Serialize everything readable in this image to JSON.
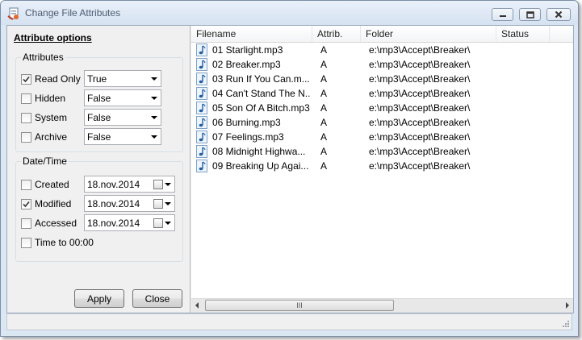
{
  "window": {
    "title": "Change File Attributes"
  },
  "left_panel": {
    "heading": "Attribute options",
    "attributes_group": {
      "label": "Attributes",
      "items": [
        {
          "label": "Read Only",
          "checked": true,
          "value": "True"
        },
        {
          "label": "Hidden",
          "checked": false,
          "value": "False"
        },
        {
          "label": "System",
          "checked": false,
          "value": "False"
        },
        {
          "label": "Archive",
          "checked": false,
          "value": "False"
        }
      ]
    },
    "datetime_group": {
      "label": "Date/Time",
      "items": [
        {
          "label": "Created",
          "checked": false,
          "date": "18.nov.2014"
        },
        {
          "label": "Modified",
          "checked": true,
          "date": "18.nov.2014"
        },
        {
          "label": "Accessed",
          "checked": false,
          "date": "18.nov.2014"
        }
      ],
      "time_label": "Time to 00:00",
      "time_checked": false
    },
    "apply_label": "Apply",
    "close_label": "Close"
  },
  "list": {
    "columns": [
      "Filename",
      "Attrib.",
      "Folder",
      "Status"
    ],
    "rows": [
      {
        "filename": "01 Starlight.mp3",
        "attrib": "A",
        "folder": "e:\\mp3\\Accept\\Breaker\\",
        "status": ""
      },
      {
        "filename": "02 Breaker.mp3",
        "attrib": "A",
        "folder": "e:\\mp3\\Accept\\Breaker\\",
        "status": ""
      },
      {
        "filename": "03 Run If You Can.m...",
        "attrib": "A",
        "folder": "e:\\mp3\\Accept\\Breaker\\",
        "status": ""
      },
      {
        "filename": "04 Can't Stand The N...",
        "attrib": "A",
        "folder": "e:\\mp3\\Accept\\Breaker\\",
        "status": ""
      },
      {
        "filename": "05 Son Of A Bitch.mp3",
        "attrib": "A",
        "folder": "e:\\mp3\\Accept\\Breaker\\",
        "status": ""
      },
      {
        "filename": "06 Burning.mp3",
        "attrib": "A",
        "folder": "e:\\mp3\\Accept\\Breaker\\",
        "status": ""
      },
      {
        "filename": "07 Feelings.mp3",
        "attrib": "A",
        "folder": "e:\\mp3\\Accept\\Breaker\\",
        "status": ""
      },
      {
        "filename": "08 Midnight Highwa...",
        "attrib": "A",
        "folder": "e:\\mp3\\Accept\\Breaker\\",
        "status": ""
      },
      {
        "filename": "09 Breaking Up Agai...",
        "attrib": "A",
        "folder": "e:\\mp3\\Accept\\Breaker\\",
        "status": ""
      }
    ],
    "scroll_thumb_grip": "III"
  },
  "icons": {
    "file": "music-note-icon",
    "app": "attributes-app-icon"
  }
}
